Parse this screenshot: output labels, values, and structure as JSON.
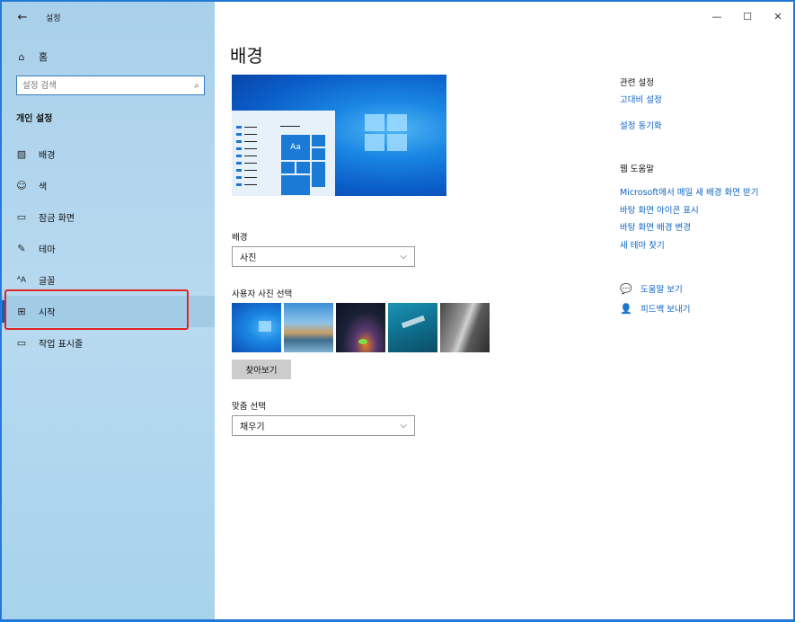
{
  "app": {
    "title": "설정",
    "back_glyph": "←"
  },
  "window_controls": {
    "minimize": "—",
    "maximize": "☐",
    "close": "✕"
  },
  "sidebar": {
    "home_label": "홈",
    "search_placeholder": "설정 검색",
    "section_title": "개인 설정",
    "items": [
      {
        "label": "배경",
        "icon": "picture-icon",
        "glyph": "▨"
      },
      {
        "label": "색",
        "icon": "palette-icon",
        "glyph": "☺"
      },
      {
        "label": "잠금 화면",
        "icon": "lock-screen-icon",
        "glyph": "▭"
      },
      {
        "label": "테마",
        "icon": "theme-brush-icon",
        "glyph": "✎"
      },
      {
        "label": "글꼴",
        "icon": "font-icon",
        "glyph": "ᴬA"
      },
      {
        "label": "시작",
        "icon": "start-menu-icon",
        "glyph": "⊞"
      },
      {
        "label": "작업 표시줄",
        "icon": "taskbar-icon",
        "glyph": "▭"
      }
    ],
    "selected_index": 5
  },
  "main": {
    "page_title": "배경",
    "preview_tile_label": "Aa",
    "background": {
      "label": "배경",
      "value": "사진"
    },
    "choose_picture_label": "사용자 사진 선택",
    "browse_label": "찾아보기",
    "fit": {
      "label": "맞춤 선택",
      "value": "채우기"
    }
  },
  "related": {
    "title": "관련 설정",
    "links": [
      "고대비 설정",
      "설정 동기화"
    ]
  },
  "web_help": {
    "title": "웹 도움말",
    "links": [
      "Microsoft에서 매일 새 배경 화면 받기",
      "바탕 화면 아이콘 표시",
      "바탕 화면 배경 변경",
      "새 테마 찾기"
    ]
  },
  "support": {
    "get_help": "도움말 보기",
    "feedback": "피드백 보내기"
  }
}
